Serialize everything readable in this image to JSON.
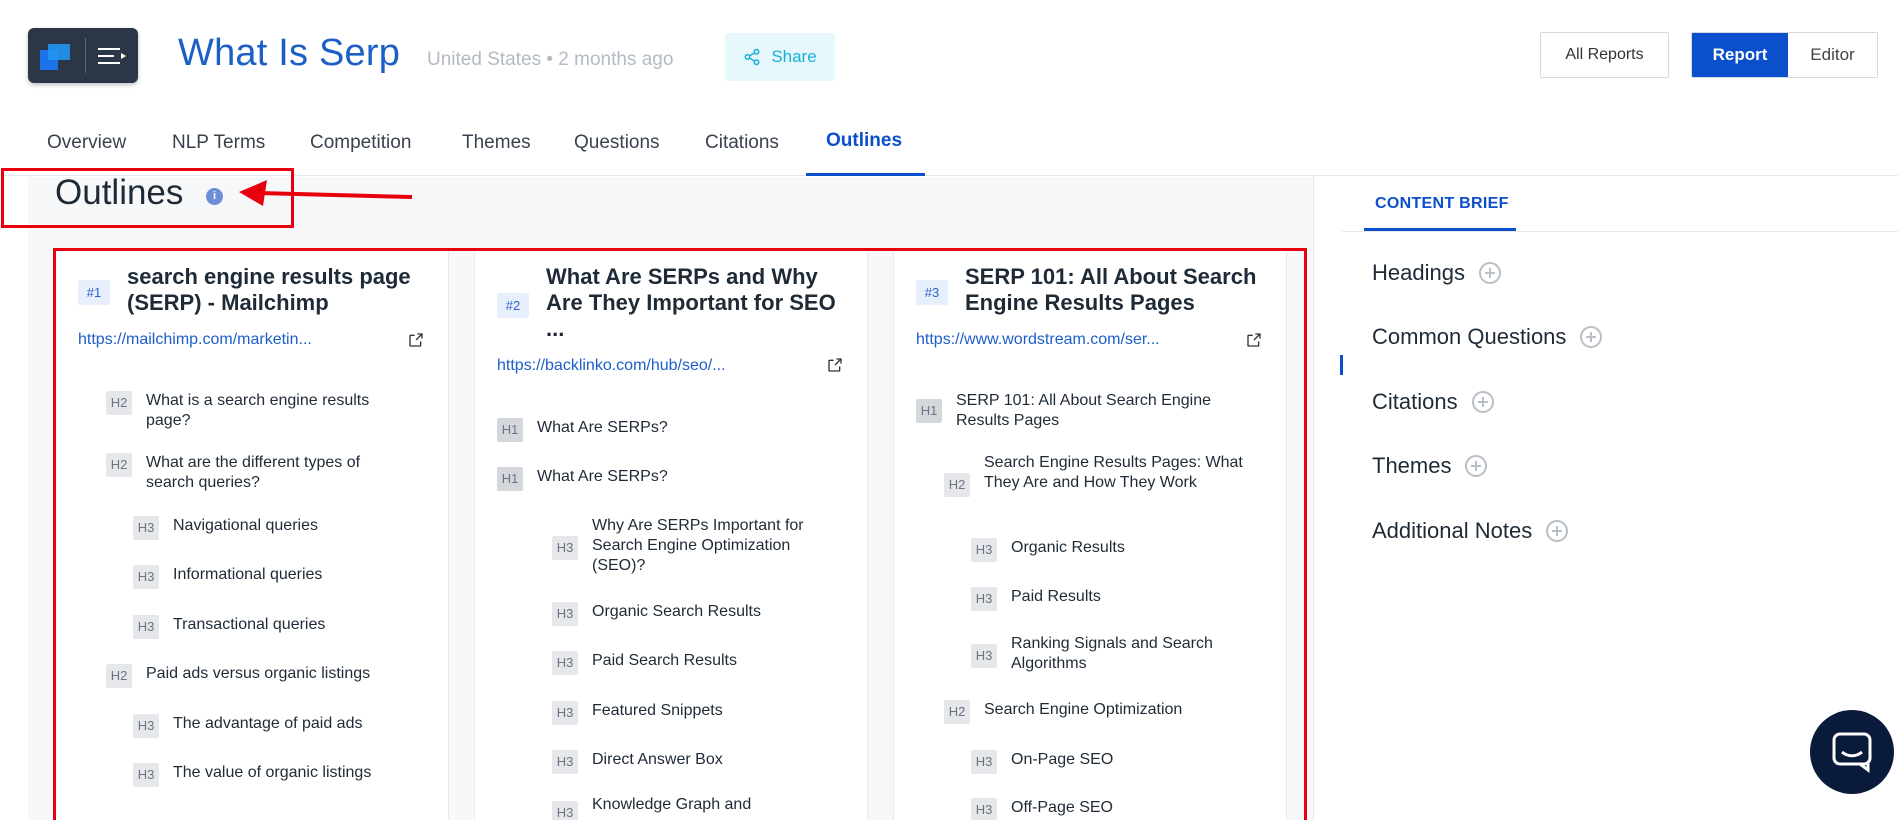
{
  "header": {
    "title": "What Is Serp",
    "meta": "United States • 2 months ago",
    "share_label": "Share",
    "all_reports_label": "All Reports",
    "report_label": "Report",
    "editor_label": "Editor"
  },
  "tabs": [
    "Overview",
    "NLP Terms",
    "Competition",
    "Themes",
    "Questions",
    "Citations",
    "Outlines"
  ],
  "active_tab": "Outlines",
  "outlines": {
    "title": "Outlines",
    "info": "i",
    "columns": [
      {
        "rank": "#1",
        "title": "search engine results page (SERP) - Mailchimp",
        "url": "https://mailchimp.com/marketin...",
        "headings": [
          {
            "level": "H2",
            "text": "What is a search engine results page?"
          },
          {
            "level": "H2",
            "text": "What are the different types of search queries?"
          },
          {
            "level": "H3",
            "text": "Navigational queries"
          },
          {
            "level": "H3",
            "text": "Informational queries"
          },
          {
            "level": "H3",
            "text": "Transactional queries"
          },
          {
            "level": "H2",
            "text": "Paid ads versus organic listings"
          },
          {
            "level": "H3",
            "text": "The advantage of paid ads"
          },
          {
            "level": "H3",
            "text": "The value of organic listings"
          }
        ]
      },
      {
        "rank": "#2",
        "title": "What Are SERPs and Why Are They Important for SEO ...",
        "url": "https://backlinko.com/hub/seo/...",
        "headings": [
          {
            "level": "H1",
            "text": "What Are SERPs?"
          },
          {
            "level": "H1",
            "text": "What Are SERPs?"
          },
          {
            "level": "H3",
            "text": "Why Are SERPs Important for Search Engine Optimization (SEO)?"
          },
          {
            "level": "H3",
            "text": "Organic Search Results"
          },
          {
            "level": "H3",
            "text": "Paid Search Results"
          },
          {
            "level": "H3",
            "text": "Featured Snippets"
          },
          {
            "level": "H3",
            "text": "Direct Answer Box"
          },
          {
            "level": "H3",
            "text": "Knowledge Graph and"
          }
        ]
      },
      {
        "rank": "#3",
        "title": "SERP 101: All About Search Engine Results Pages",
        "url": "https://www.wordstream.com/ser...",
        "headings": [
          {
            "level": "H1",
            "text": "SERP 101: All About Search Engine Results Pages"
          },
          {
            "level": "H2",
            "text": "Search Engine Results Pages: What They Are and How They Work"
          },
          {
            "level": "H3",
            "text": "Organic Results"
          },
          {
            "level": "H3",
            "text": "Paid Results"
          },
          {
            "level": "H3",
            "text": "Ranking Signals and Search Algorithms"
          },
          {
            "level": "H2",
            "text": "Search Engine Optimization"
          },
          {
            "level": "H3",
            "text": "On-Page SEO"
          },
          {
            "level": "H3",
            "text": "Off-Page SEO"
          }
        ]
      }
    ]
  },
  "brief": {
    "tab_label": "CONTENT BRIEF",
    "sections": [
      "Headings",
      "Common Questions",
      "Citations",
      "Themes",
      "Additional Notes"
    ]
  },
  "icons": {
    "share": "share-icon",
    "external": "external-link-icon",
    "chat": "chat-icon",
    "add": "plus-circle-icon"
  },
  "colors": {
    "brand_blue": "#0b4fcc",
    "title_blue": "#1c5fc7",
    "share_bg": "#e6f8fb",
    "annotation_red": "#e8000f"
  }
}
